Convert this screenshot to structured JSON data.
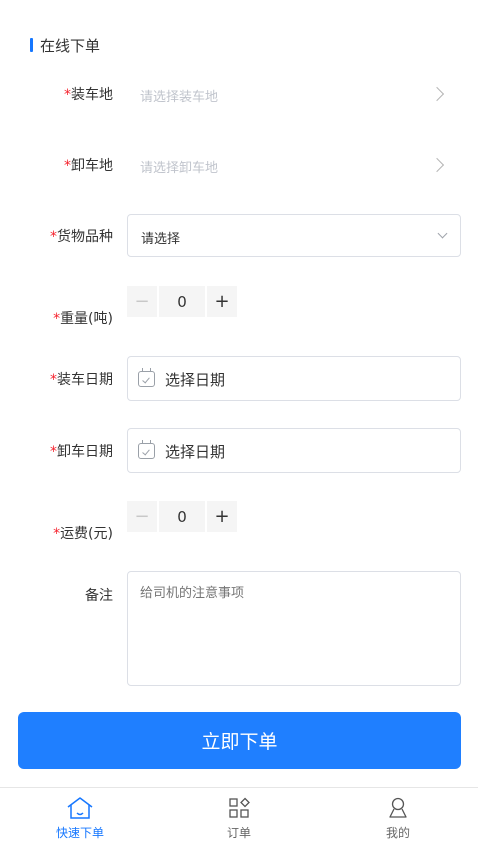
{
  "section": {
    "title": "在线下单"
  },
  "form": {
    "loading_place": {
      "required_mark": "*",
      "label": "装车地",
      "placeholder": "请选择装车地"
    },
    "unloading_place": {
      "required_mark": "*",
      "label": "卸车地",
      "placeholder": "请选择卸车地"
    },
    "goods_type": {
      "required_mark": "*",
      "label": "货物品种",
      "value": "请选择"
    },
    "weight": {
      "required_mark": "*",
      "label": "重量(吨)",
      "minus": "−",
      "value": "0",
      "plus": "+"
    },
    "loading_date": {
      "required_mark": "*",
      "label": "装车日期",
      "value": "选择日期"
    },
    "unloading_date": {
      "required_mark": "*",
      "label": "卸车日期",
      "value": "选择日期"
    },
    "freight": {
      "required_mark": "*",
      "label": "运费(元)",
      "minus": "−",
      "value": "0",
      "plus": "+"
    },
    "remark": {
      "label": "备注",
      "placeholder": "给司机的注意事项"
    }
  },
  "submit": {
    "label": "立即下单"
  },
  "tabbar": {
    "items": [
      {
        "label": "快速下单",
        "icon": "home-icon",
        "active": true
      },
      {
        "label": "订单",
        "icon": "orders-icon",
        "active": false
      },
      {
        "label": "我的",
        "icon": "user-icon",
        "active": false
      }
    ]
  },
  "colors": {
    "accent": "#1677ff",
    "button": "#1f7fff",
    "required": "#f5222d",
    "placeholder": "#c0c4cc"
  }
}
